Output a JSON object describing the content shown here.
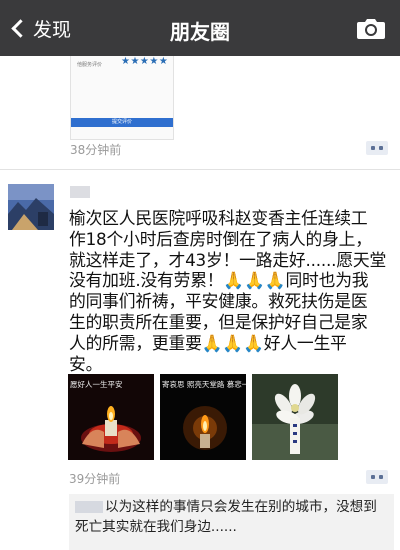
{
  "nav": {
    "back_label": "发现",
    "title": "朋友圈",
    "camera_icon": "camera-icon"
  },
  "previous_post": {
    "card_text": "他服务评价",
    "stars": "★★★★★",
    "button_label": "提交评价",
    "timestamp": "38分钟前",
    "accent_color": "#2f6fcf"
  },
  "post": {
    "text": "榆次区人民医院呼吸科赵变香主任连续工\n作18个小时后查房时倒在了病人的身上，\n就这样走了，才43岁！一路走好......愿天堂\n没有加班.没有劳累！🙏🙏🙏同时也为我\n的同事们祈祷，平安健康。救死扶伤是医\n生的职责所在重要，但是保护好自己是家\n人的所需，更重要🙏🙏🙏好人一生平\n安。",
    "photos": [
      {
        "caption": "愿好人一生平安",
        "kind": "candle-hands"
      },
      {
        "caption": "寄哀思 照亮天堂路 慕悲一",
        "kind": "candle-dark"
      },
      {
        "caption": "",
        "kind": "white-flower"
      }
    ],
    "timestamp": "39分钟前",
    "comment": "以为这样的事情只会发生在别的城市，没想到死亡其实就在我们身边......"
  }
}
